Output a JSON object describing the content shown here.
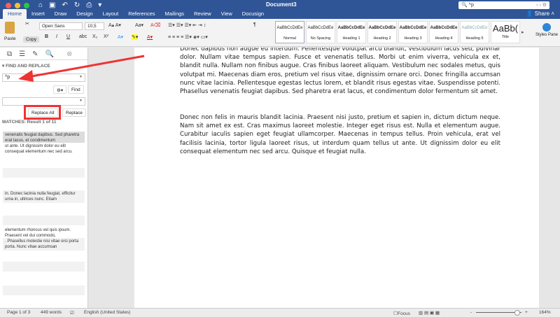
{
  "titlebar": {
    "title": "Document3",
    "search_value": "^p",
    "share": "Share"
  },
  "tabs": [
    "Home",
    "Insert",
    "Draw",
    "Design",
    "Layout",
    "References",
    "Mailings",
    "Review",
    "View",
    "Docusign"
  ],
  "ribbon": {
    "paste": "Paste",
    "copy_tooltip": "Copy",
    "font": "Open Sans",
    "size": "10,5",
    "bold": "B",
    "italic": "I",
    "underline": "U",
    "pilcrow": "¶",
    "styles": [
      {
        "sample": "AaBbCcDdEe",
        "name": "Normal"
      },
      {
        "sample": "AaBbCcDdEe",
        "name": "No Spacing"
      },
      {
        "sample": "AaBbCcDdEe",
        "name": "Heading 1"
      },
      {
        "sample": "AaBbCcDdEe",
        "name": "Heading 2"
      },
      {
        "sample": "AaBbCcDdEe",
        "name": "Heading 3"
      },
      {
        "sample": "AaBbCcDdEe",
        "name": "Heading 4"
      },
      {
        "sample": "AaBbCcDdEe",
        "name": "Heading 5"
      },
      {
        "sample": "AaBb(",
        "name": "Title"
      }
    ],
    "styles_pane": "Styles Pane"
  },
  "sidebar": {
    "header": "FIND AND REPLACE",
    "find_value": "^p",
    "find_button": "Find",
    "replace_value": "",
    "replace_all": "Replace All",
    "replace": "Replace",
    "matches": "MATCHES: Result 1 of 11",
    "results": [
      "venenatis feugiat dapibus. Sed pharetra erat lacus, et condimentum",
      "ut ante. Ut dignissim dolor eu elit consequat elementum nec sed arcu.",
      "in. Donec lacinia nulla feugiat, efficitur urna in, ultrices nunc. Etiam",
      "elementum rhoncus vel quis ipsum. Praesent vel dui commodo,",
      ". Phasellus molestie nisi vitae orci porta porta. Nunc vitae accumsan"
    ]
  },
  "document": {
    "paragraphs": [
      "Donec dapibus non augue eu interdum. Pellentesque volutpat arcu blandit, vestibulum lacus sed, pulvinar dolor. Nullam vitae tempus sapien. Fusce et venenatis tellus. Morbi ut enim viverra, vehicula ex et, blandit nulla. Nullam non finibus augue. Cras finibus laoreet aliquam. Vestibulum nec sodales metus, quis volutpat mi. Maecenas diam eros, pretium vel risus vitae, dignissim ornare orci. Donec fringilla accumsan nunc vitae lacinia. Pellentesque egestas lectus lorem, et blandit risus egestas vitae. Suspendisse potenti. Phasellus venenatis feugiat dapibus. Sed pharetra erat lacus, et condimentum dolor fermentum sit amet.",
      "Donec non felis in mauris blandit lacinia. Praesent nisi justo, pretium et sapien in, dictum dictum neque. Nam sit amet ex est. Cras maximus laoreet molestie. Integer eget risus est. Nulla et elementum augue. Curabitur iaculis sapien eget feugiat ullamcorper. Maecenas in tempus tellus. Proin vehicula, erat vel facilisis lacinia, tortor ligula laoreet risus, ut interdum quam tellus ut ante. Ut dignissim dolor eu elit consequat elementum nec sed arcu. Quisque et feugiat nulla."
    ]
  },
  "status": {
    "page": "Page 1 of 3",
    "words": "449 words",
    "language": "English (United States)",
    "focus": "Focus",
    "zoom": "164%",
    "zoom_minus": "-",
    "zoom_plus": "+"
  },
  "colors": {
    "title_blue": "#2f5597",
    "annotation_red": "#e33333"
  }
}
